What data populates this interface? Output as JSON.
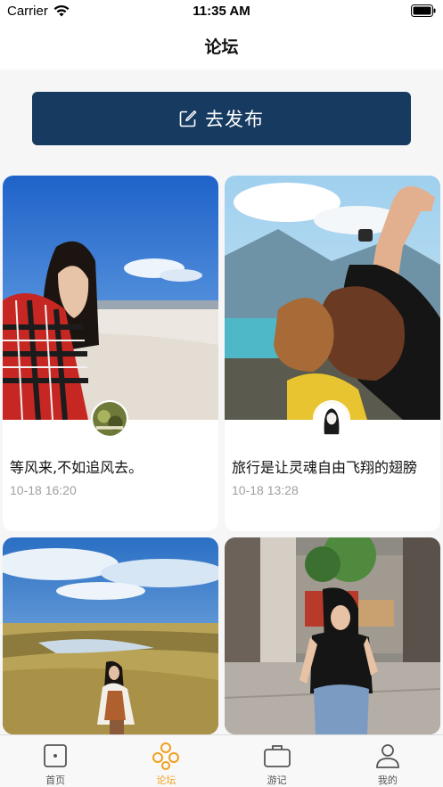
{
  "status_bar": {
    "carrier": "Carrier",
    "time": "11:35 AM",
    "icons": [
      "wifi-icon",
      "battery-icon"
    ]
  },
  "nav": {
    "title": "论坛"
  },
  "publish_button": {
    "label": "去发布",
    "icon": "edit-icon"
  },
  "posts": [
    {
      "title": "等风来,不如追风去。",
      "date": "10-18 16:20",
      "avatar": "avatar-landscape"
    },
    {
      "title": "旅行是让灵魂自由飞翔的翅膀",
      "date": "10-18 13:28",
      "avatar": "avatar-girl-sketch"
    },
    {
      "title": "",
      "date": "",
      "avatar": ""
    },
    {
      "title": "",
      "date": "",
      "avatar": ""
    }
  ],
  "tab_bar": {
    "active_color": "#f0a020",
    "items": [
      {
        "label": "首页",
        "icon": "home-icon",
        "active": false
      },
      {
        "label": "论坛",
        "icon": "forum-icon",
        "active": true
      },
      {
        "label": "游记",
        "icon": "briefcase-icon",
        "active": false
      },
      {
        "label": "我的",
        "icon": "profile-icon",
        "active": false
      }
    ]
  },
  "colors": {
    "publish_button_bg": "#163a60",
    "background": "#f7f6f6"
  }
}
